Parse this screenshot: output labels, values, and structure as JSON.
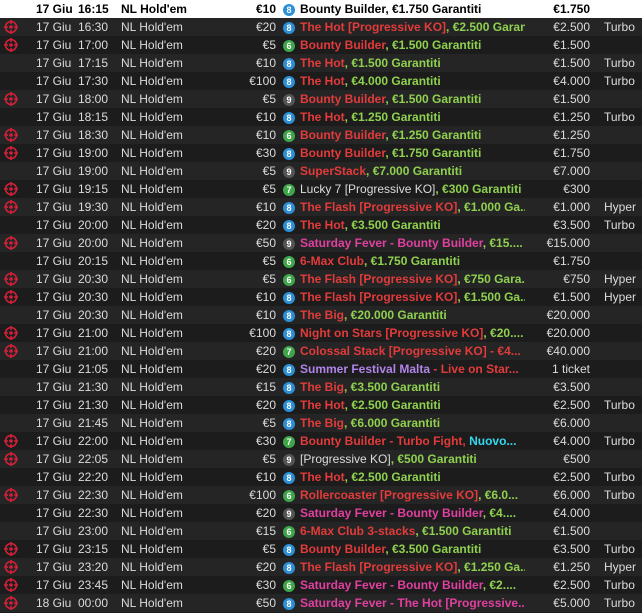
{
  "colors": {
    "name_red": "#e23b3b",
    "gtd_green": "#8fd14f",
    "pink": "#e040a0",
    "purple": "#b084e8",
    "cyan": "#35d8ef",
    "badge_blue": "#2d8fd6",
    "badge_green": "#3fa64a",
    "badge_dark": "#555555",
    "target_red": "#d0203a"
  },
  "rows": [
    {
      "icon": false,
      "date": "17 Giu",
      "time": "16:15",
      "game": "NL Hold'em",
      "buyin": "€10",
      "num": "8",
      "badge": "badge_blue",
      "parts": [
        {
          "t": "Bounty Builder, €1.750 Garantiti",
          "c": "black"
        }
      ],
      "gtd": "€1.750",
      "type": "",
      "selected": true
    },
    {
      "icon": true,
      "date": "17 Giu",
      "time": "16:30",
      "game": "NL Hold'em",
      "buyin": "€20",
      "num": "8",
      "badge": "badge_blue",
      "parts": [
        {
          "t": "The Hot [Progressive KO]",
          "c": "name_red"
        },
        {
          "t": ", €2.500 Garanti...",
          "c": "gtd_green"
        }
      ],
      "gtd": "€2.500",
      "type": "Turbo"
    },
    {
      "icon": true,
      "date": "17 Giu",
      "time": "17:00",
      "game": "NL Hold'em",
      "buyin": "€5",
      "num": "6",
      "badge": "badge_green",
      "parts": [
        {
          "t": "Bounty Builder",
          "c": "name_red"
        },
        {
          "t": ", €1.500 Garantiti",
          "c": "gtd_green"
        }
      ],
      "gtd": "€1.500",
      "type": ""
    },
    {
      "icon": false,
      "date": "17 Giu",
      "time": "17:15",
      "game": "NL Hold'em",
      "buyin": "€10",
      "num": "8",
      "badge": "badge_blue",
      "parts": [
        {
          "t": "The Hot",
          "c": "name_red"
        },
        {
          "t": ", €1.500 Garantiti",
          "c": "gtd_green"
        }
      ],
      "gtd": "€1.500",
      "type": "Turbo"
    },
    {
      "icon": false,
      "date": "17 Giu",
      "time": "17:30",
      "game": "NL Hold'em",
      "buyin": "€100",
      "num": "8",
      "badge": "badge_blue",
      "parts": [
        {
          "t": "The Hot",
          "c": "name_red"
        },
        {
          "t": ", €4.000 Garantiti",
          "c": "gtd_green"
        }
      ],
      "gtd": "€4.000",
      "type": "Turbo"
    },
    {
      "icon": true,
      "date": "17 Giu",
      "time": "18:00",
      "game": "NL Hold'em",
      "buyin": "€5",
      "num": "9",
      "badge": "badge_dark",
      "parts": [
        {
          "t": "Bounty Builder",
          "c": "name_red"
        },
        {
          "t": ", €1.500 Garantiti",
          "c": "gtd_green"
        }
      ],
      "gtd": "€1.500",
      "type": ""
    },
    {
      "icon": false,
      "date": "17 Giu",
      "time": "18:15",
      "game": "NL Hold'em",
      "buyin": "€10",
      "num": "8",
      "badge": "badge_blue",
      "parts": [
        {
          "t": "The Hot",
          "c": "name_red"
        },
        {
          "t": ", €1.250 Garantiti",
          "c": "gtd_green"
        }
      ],
      "gtd": "€1.250",
      "type": "Turbo"
    },
    {
      "icon": true,
      "date": "17 Giu",
      "time": "18:30",
      "game": "NL Hold'em",
      "buyin": "€10",
      "num": "6",
      "badge": "badge_green",
      "parts": [
        {
          "t": "Bounty Builder",
          "c": "name_red"
        },
        {
          "t": ", €1.250 Garantiti",
          "c": "gtd_green"
        }
      ],
      "gtd": "€1.250",
      "type": ""
    },
    {
      "icon": true,
      "date": "17 Giu",
      "time": "19:00",
      "game": "NL Hold'em",
      "buyin": "€30",
      "num": "8",
      "badge": "badge_blue",
      "parts": [
        {
          "t": "Bounty Builder",
          "c": "name_red"
        },
        {
          "t": ", €1.750 Garantiti",
          "c": "gtd_green"
        }
      ],
      "gtd": "€1.750",
      "type": ""
    },
    {
      "icon": false,
      "date": "17 Giu",
      "time": "19:00",
      "game": "NL Hold'em",
      "buyin": "€5",
      "num": "9",
      "badge": "badge_dark",
      "parts": [
        {
          "t": "SuperStack",
          "c": "name_red"
        },
        {
          "t": ", €7.000 Garantiti",
          "c": "gtd_green"
        }
      ],
      "gtd": "€7.000",
      "type": ""
    },
    {
      "icon": true,
      "date": "17 Giu",
      "time": "19:15",
      "game": "NL Hold'em",
      "buyin": "€5",
      "num": "7",
      "badge": "badge_green",
      "parts": [
        {
          "t": "Lucky 7 [Progressive KO]",
          "c": "plain"
        },
        {
          "t": ", €300 Garantiti",
          "c": "gtd_green"
        }
      ],
      "gtd": "€300",
      "type": ""
    },
    {
      "icon": true,
      "date": "17 Giu",
      "time": "19:30",
      "game": "NL Hold'em",
      "buyin": "€10",
      "num": "8",
      "badge": "badge_blue",
      "parts": [
        {
          "t": "The Flash [Progressive KO]",
          "c": "name_red"
        },
        {
          "t": ", €1.000 Ga...",
          "c": "gtd_green"
        }
      ],
      "gtd": "€1.000",
      "type": "Hyper"
    },
    {
      "icon": false,
      "date": "17 Giu",
      "time": "20:00",
      "game": "NL Hold'em",
      "buyin": "€20",
      "num": "8",
      "badge": "badge_blue",
      "parts": [
        {
          "t": "The Hot",
          "c": "name_red"
        },
        {
          "t": ", €3.500 Garantiti",
          "c": "gtd_green"
        }
      ],
      "gtd": "€3.500",
      "type": "Turbo"
    },
    {
      "icon": true,
      "date": "17 Giu",
      "time": "20:00",
      "game": "NL Hold'em",
      "buyin": "€50",
      "num": "9",
      "badge": "badge_dark",
      "parts": [
        {
          "t": "Saturday Fever - Bounty Builder",
          "c": "pink"
        },
        {
          "t": ", €15....",
          "c": "gtd_green"
        }
      ],
      "gtd": "€15.000",
      "type": ""
    },
    {
      "icon": false,
      "date": "17 Giu",
      "time": "20:15",
      "game": "NL Hold'em",
      "buyin": "€5",
      "num": "6",
      "badge": "badge_green",
      "parts": [
        {
          "t": "6-Max Club",
          "c": "name_red"
        },
        {
          "t": ", €1.750 Garantiti",
          "c": "gtd_green"
        }
      ],
      "gtd": "€1.750",
      "type": ""
    },
    {
      "icon": true,
      "date": "17 Giu",
      "time": "20:30",
      "game": "NL Hold'em",
      "buyin": "€5",
      "num": "6",
      "badge": "badge_green",
      "parts": [
        {
          "t": "The Flash [Progressive KO]",
          "c": "name_red"
        },
        {
          "t": ", €750 Gara...",
          "c": "gtd_green"
        }
      ],
      "gtd": "€750",
      "type": "Hyper"
    },
    {
      "icon": true,
      "date": "17 Giu",
      "time": "20:30",
      "game": "NL Hold'em",
      "buyin": "€10",
      "num": "8",
      "badge": "badge_blue",
      "parts": [
        {
          "t": "The Flash [Progressive KO]",
          "c": "name_red"
        },
        {
          "t": ", €1.500 Ga...",
          "c": "gtd_green"
        }
      ],
      "gtd": "€1.500",
      "type": "Hyper"
    },
    {
      "icon": false,
      "date": "17 Giu",
      "time": "20:30",
      "game": "NL Hold'em",
      "buyin": "€10",
      "num": "8",
      "badge": "badge_blue",
      "parts": [
        {
          "t": "The Big",
          "c": "name_red"
        },
        {
          "t": ", €20.000 Garantiti",
          "c": "gtd_green"
        }
      ],
      "gtd": "€20.000",
      "type": ""
    },
    {
      "icon": true,
      "date": "17 Giu",
      "time": "21:00",
      "game": "NL Hold'em",
      "buyin": "€100",
      "num": "8",
      "badge": "badge_blue",
      "parts": [
        {
          "t": "Night on Stars [Progressive KO]",
          "c": "name_red"
        },
        {
          "t": ", €20....",
          "c": "gtd_green"
        }
      ],
      "gtd": "€20.000",
      "type": ""
    },
    {
      "icon": true,
      "date": "17 Giu",
      "time": "21:00",
      "game": "NL Hold'em",
      "buyin": "€20",
      "num": "7",
      "badge": "badge_green",
      "parts": [
        {
          "t": "Colossal Stack [Progressive KO]",
          "c": "name_red"
        },
        {
          "t": " - €4...",
          "c": "name_red"
        }
      ],
      "gtd": "€40.000",
      "type": ""
    },
    {
      "icon": false,
      "date": "17 Giu",
      "time": "21:05",
      "game": "NL Hold'em",
      "buyin": "€20",
      "num": "8",
      "badge": "badge_blue",
      "parts": [
        {
          "t": "Summer Festival Malta",
          "c": "purple"
        },
        {
          "t": " - Live on Star...",
          "c": "name_red"
        }
      ],
      "gtd": "1 ticket",
      "type": ""
    },
    {
      "icon": false,
      "date": "17 Giu",
      "time": "21:30",
      "game": "NL Hold'em",
      "buyin": "€15",
      "num": "8",
      "badge": "badge_blue",
      "parts": [
        {
          "t": "The Big",
          "c": "name_red"
        },
        {
          "t": ", €3.500 Garantiti",
          "c": "gtd_green"
        }
      ],
      "gtd": "€3.500",
      "type": ""
    },
    {
      "icon": false,
      "date": "17 Giu",
      "time": "21:30",
      "game": "NL Hold'em",
      "buyin": "€20",
      "num": "8",
      "badge": "badge_blue",
      "parts": [
        {
          "t": "The Hot",
          "c": "name_red"
        },
        {
          "t": ", €2.500 Garantiti",
          "c": "gtd_green"
        }
      ],
      "gtd": "€2.500",
      "type": "Turbo"
    },
    {
      "icon": false,
      "date": "17 Giu",
      "time": "21:45",
      "game": "NL Hold'em",
      "buyin": "€5",
      "num": "8",
      "badge": "badge_blue",
      "parts": [
        {
          "t": "The Big",
          "c": "name_red"
        },
        {
          "t": ", €6.000 Garantiti",
          "c": "gtd_green"
        }
      ],
      "gtd": "€6.000",
      "type": ""
    },
    {
      "icon": true,
      "date": "17 Giu",
      "time": "22:00",
      "game": "NL Hold'em",
      "buyin": "€30",
      "num": "7",
      "badge": "badge_green",
      "parts": [
        {
          "t": "Bounty Builder - Turbo Fight",
          "c": "name_red"
        },
        {
          "t": ", ",
          "c": "name_red"
        },
        {
          "t": "Nuovo...",
          "c": "cyan"
        }
      ],
      "gtd": "€4.000",
      "type": "Turbo"
    },
    {
      "icon": true,
      "date": "17 Giu",
      "time": "22:05",
      "game": "NL Hold'em",
      "buyin": "€5",
      "num": "9",
      "badge": "badge_dark",
      "parts": [
        {
          "t": "[Progressive KO]",
          "c": "plain"
        },
        {
          "t": ", €500 Garantiti",
          "c": "gtd_green"
        }
      ],
      "gtd": "€500",
      "type": ""
    },
    {
      "icon": false,
      "date": "17 Giu",
      "time": "22:20",
      "game": "NL Hold'em",
      "buyin": "€10",
      "num": "8",
      "badge": "badge_blue",
      "parts": [
        {
          "t": "The Hot",
          "c": "name_red"
        },
        {
          "t": ", €2.500 Garantiti",
          "c": "gtd_green"
        }
      ],
      "gtd": "€2.500",
      "type": "Turbo"
    },
    {
      "icon": true,
      "date": "17 Giu",
      "time": "22:30",
      "game": "NL Hold'em",
      "buyin": "€100",
      "num": "6",
      "badge": "badge_green",
      "parts": [
        {
          "t": "Rollercoaster [Progressive KO]",
          "c": "name_red"
        },
        {
          "t": ", €6.0...",
          "c": "gtd_green"
        }
      ],
      "gtd": "€6.000",
      "type": "Turbo"
    },
    {
      "icon": false,
      "date": "17 Giu",
      "time": "22:30",
      "game": "NL Hold'em",
      "buyin": "€20",
      "num": "9",
      "badge": "badge_dark",
      "parts": [
        {
          "t": "Saturday Fever - Bounty Builder",
          "c": "pink"
        },
        {
          "t": ", €4....",
          "c": "gtd_green"
        }
      ],
      "gtd": "€4.000",
      "type": ""
    },
    {
      "icon": false,
      "date": "17 Giu",
      "time": "23:00",
      "game": "NL Hold'em",
      "buyin": "€15",
      "num": "6",
      "badge": "badge_green",
      "parts": [
        {
          "t": "6-Max Club 3-stacks",
          "c": "name_red"
        },
        {
          "t": ", €1.500 Garantiti",
          "c": "gtd_green"
        }
      ],
      "gtd": "€1.500",
      "type": ""
    },
    {
      "icon": true,
      "date": "17 Giu",
      "time": "23:15",
      "game": "NL Hold'em",
      "buyin": "€5",
      "num": "8",
      "badge": "badge_blue",
      "parts": [
        {
          "t": "Bounty Builder",
          "c": "name_red"
        },
        {
          "t": ", €3.500 Garantiti",
          "c": "gtd_green"
        }
      ],
      "gtd": "€3.500",
      "type": "Turbo"
    },
    {
      "icon": true,
      "date": "17 Giu",
      "time": "23:20",
      "game": "NL Hold'em",
      "buyin": "€20",
      "num": "8",
      "badge": "badge_blue",
      "parts": [
        {
          "t": "The Flash [Progressive KO]",
          "c": "name_red"
        },
        {
          "t": ", €1.250 Ga...",
          "c": "gtd_green"
        }
      ],
      "gtd": "€1.250",
      "type": "Hyper"
    },
    {
      "icon": true,
      "date": "17 Giu",
      "time": "23:45",
      "game": "NL Hold'em",
      "buyin": "€30",
      "num": "6",
      "badge": "badge_green",
      "parts": [
        {
          "t": "Saturday Fever - Bounty Builder",
          "c": "pink"
        },
        {
          "t": ", €2....",
          "c": "gtd_green"
        }
      ],
      "gtd": "€2.500",
      "type": "Turbo"
    },
    {
      "icon": true,
      "date": "18 Giu",
      "time": "00:00",
      "game": "NL Hold'em",
      "buyin": "€50",
      "num": "8",
      "badge": "badge_blue",
      "parts": [
        {
          "t": "Saturday Fever - The Hot [Progressive...",
          "c": "pink"
        }
      ],
      "gtd": "€5.000",
      "type": "Turbo"
    }
  ]
}
